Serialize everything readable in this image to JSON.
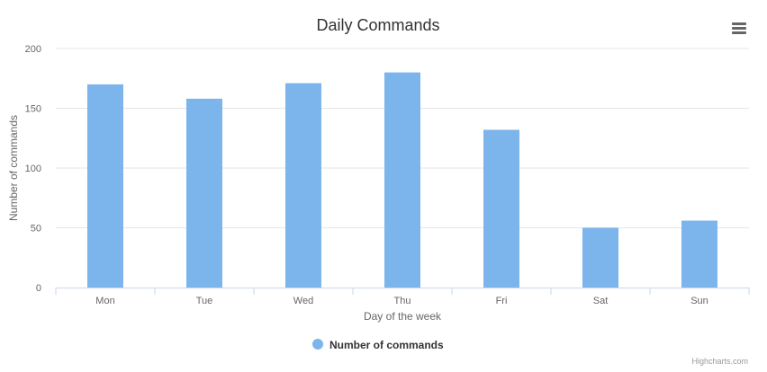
{
  "chart_data": {
    "type": "bar",
    "title": "Daily Commands",
    "categories": [
      "Mon",
      "Tue",
      "Wed",
      "Thu",
      "Fri",
      "Sat",
      "Sun"
    ],
    "series": [
      {
        "name": "Number of commands",
        "values": [
          170,
          158,
          171,
          180,
          132,
          50,
          56
        ],
        "color": "#7cb5ec"
      }
    ],
    "xlabel": "Day of the week",
    "ylabel": "Number of commands",
    "ylim": [
      0,
      200
    ],
    "yticks": [
      "0",
      "50",
      "100",
      "150",
      "200"
    ],
    "grid": true,
    "legend": "bottom-center"
  },
  "menu_icon": "hamburger-menu-icon",
  "credits": "Highcharts.com",
  "colors": {
    "bar": "#7cb5ec",
    "grid": "#e6e6e6",
    "axis": "#ccd6eb",
    "text": "#666666",
    "title": "#333333"
  }
}
